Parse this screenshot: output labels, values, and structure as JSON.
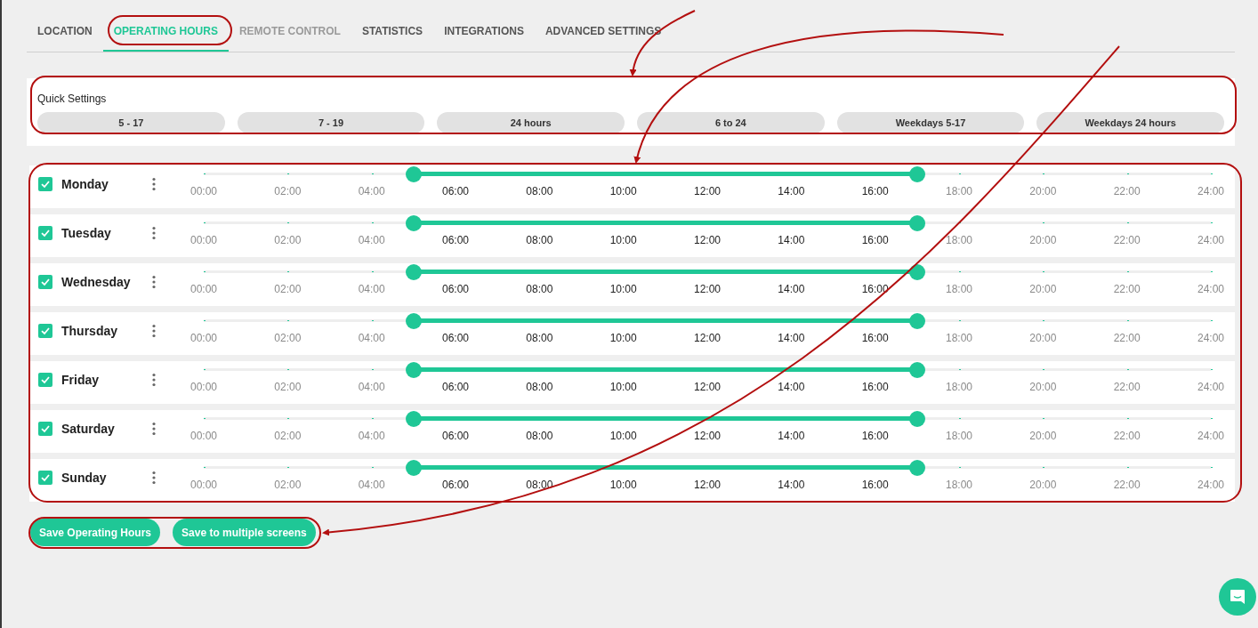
{
  "tabs": [
    {
      "label": "LOCATION",
      "selected": false,
      "disabled": false
    },
    {
      "label": "OPERATING HOURS",
      "selected": true,
      "disabled": false
    },
    {
      "label": "REMOTE CONTROL",
      "selected": false,
      "disabled": true
    },
    {
      "label": "STATISTICS",
      "selected": false,
      "disabled": false
    },
    {
      "label": "INTEGRATIONS",
      "selected": false,
      "disabled": false
    },
    {
      "label": "ADVANCED SETTINGS",
      "selected": false,
      "disabled": false
    }
  ],
  "quick_settings": {
    "title": "Quick Settings",
    "presets": [
      "5 - 17",
      "7 - 19",
      "24 hours",
      "6 to 24",
      "Weekdays 5-17",
      "Weekdays 24 hours"
    ]
  },
  "days": [
    {
      "name": "Monday",
      "checked": true,
      "slider": {
        "start": {
          "level": 0.2083
        },
        "end": {
          "level": 0.7083
        }
      },
      "ticks": [
        "00:00",
        "02:00",
        "04:00",
        "06:00",
        "08:00",
        "10:00",
        "12:00",
        "14:00",
        "16:00",
        "18:00",
        "20:00",
        "22:00",
        "24:00"
      ]
    },
    {
      "name": "Tuesday",
      "checked": true,
      "slider": {
        "start": {
          "level": 0.2083
        },
        "end": {
          "level": 0.7083
        }
      },
      "ticks": [
        "00:00",
        "02:00",
        "04:00",
        "06:00",
        "08:00",
        "10:00",
        "12:00",
        "14:00",
        "16:00",
        "18:00",
        "20:00",
        "22:00",
        "24:00"
      ]
    },
    {
      "name": "Wednesday",
      "checked": true,
      "slider": {
        "start": {
          "level": 0.2083
        },
        "end": {
          "level": 0.7083
        }
      },
      "ticks": [
        "00:00",
        "02:00",
        "04:00",
        "06:00",
        "08:00",
        "10:00",
        "12:00",
        "14:00",
        "16:00",
        "18:00",
        "20:00",
        "22:00",
        "24:00"
      ]
    },
    {
      "name": "Thursday",
      "checked": true,
      "slider": {
        "start": {
          "level": 0.2083
        },
        "end": {
          "level": 0.7083
        }
      },
      "ticks": [
        "00:00",
        "02:00",
        "04:00",
        "06:00",
        "08:00",
        "10:00",
        "12:00",
        "14:00",
        "16:00",
        "18:00",
        "20:00",
        "22:00",
        "24:00"
      ]
    },
    {
      "name": "Friday",
      "checked": true,
      "slider": {
        "start": {
          "level": 0.2083
        },
        "end": {
          "level": 0.7083
        }
      },
      "ticks": [
        "00:00",
        "02:00",
        "04:00",
        "06:00",
        "08:00",
        "10:00",
        "12:00",
        "14:00",
        "16:00",
        "18:00",
        "20:00",
        "22:00",
        "24:00"
      ]
    },
    {
      "name": "Saturday",
      "checked": true,
      "slider": {
        "start": {
          "level": 0.2083
        },
        "end": {
          "level": 0.7083
        }
      },
      "ticks": [
        "00:00",
        "02:00",
        "04:00",
        "06:00",
        "08:00",
        "10:00",
        "12:00",
        "14:00",
        "16:00",
        "18:00",
        "20:00",
        "22:00",
        "24:00"
      ]
    },
    {
      "name": "Sunday",
      "checked": true,
      "slider": {
        "start": {
          "level": 0.2083
        },
        "end": {
          "level": 0.7083
        }
      },
      "ticks": [
        "00:00",
        "02:00",
        "04:00",
        "06:00",
        "08:00",
        "10:00",
        "12:00",
        "14:00",
        "16:00",
        "18:00",
        "20:00",
        "22:00",
        "24:00"
      ]
    }
  ],
  "actions": [
    "Save Operating Hours",
    "Save to multiple screens"
  ]
}
